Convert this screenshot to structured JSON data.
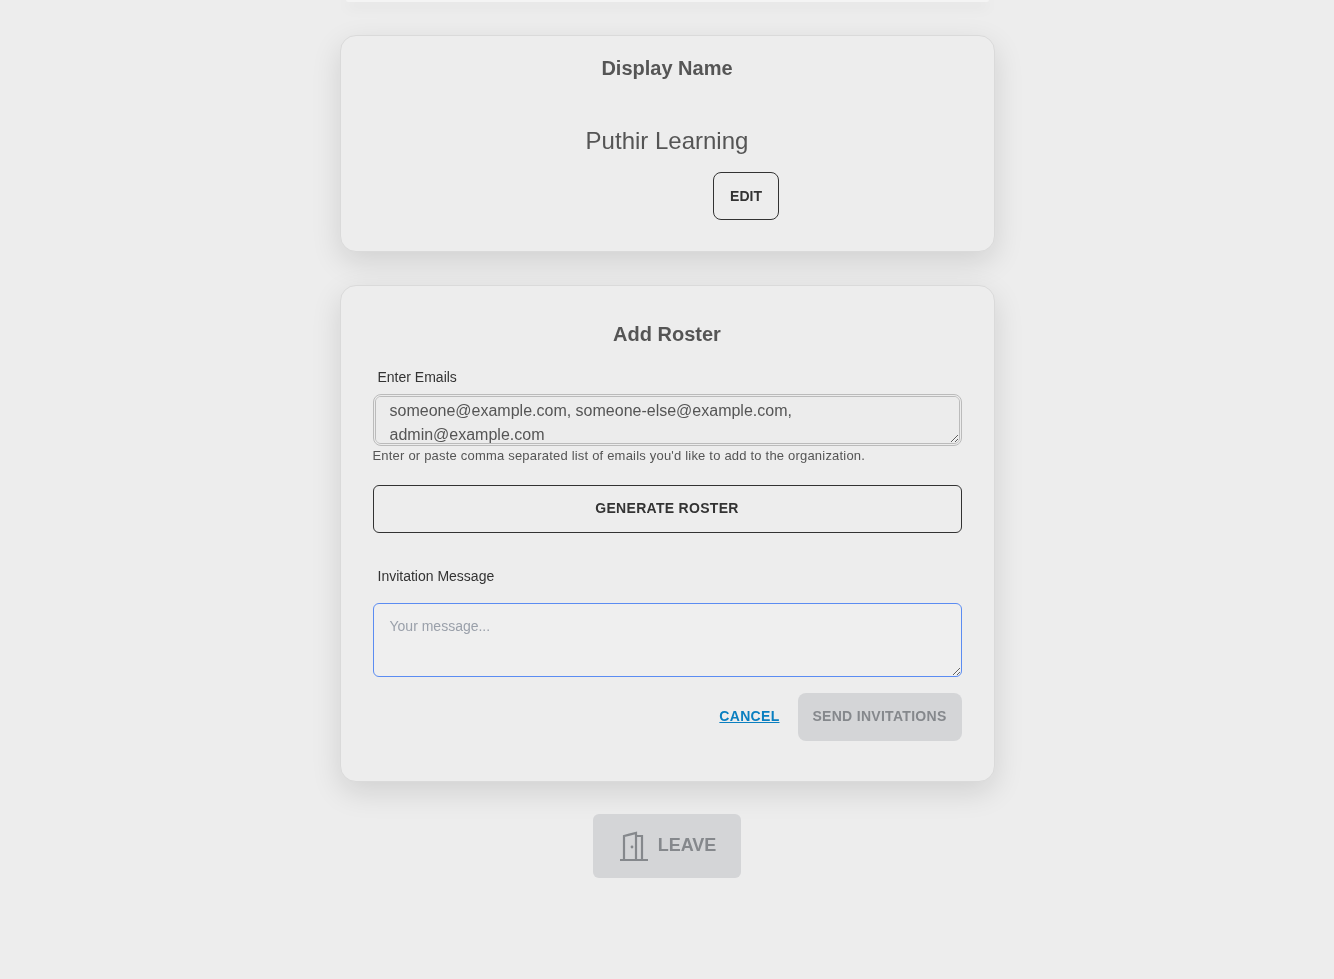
{
  "display_name_card": {
    "title": "Display Name",
    "name": "Puthir Learning",
    "edit_button": "EDIT"
  },
  "add_roster_card": {
    "title": "Add Roster",
    "emails": {
      "label": "Enter Emails",
      "value": "someone@example.com, someone-else@example.com, admin@example.com",
      "disabled": true,
      "help": "Enter or paste comma separated list of emails you'd like to add to the organization."
    },
    "generate_button": "GENERATE ROSTER",
    "message": {
      "label": "Invitation Message",
      "placeholder": "Your message...",
      "focused": true
    },
    "cancel_link": "CANCEL",
    "send_button": {
      "label": "SEND INVITATIONS",
      "disabled": true
    }
  },
  "leave_button": {
    "label": "LEAVE",
    "disabled": true
  }
}
